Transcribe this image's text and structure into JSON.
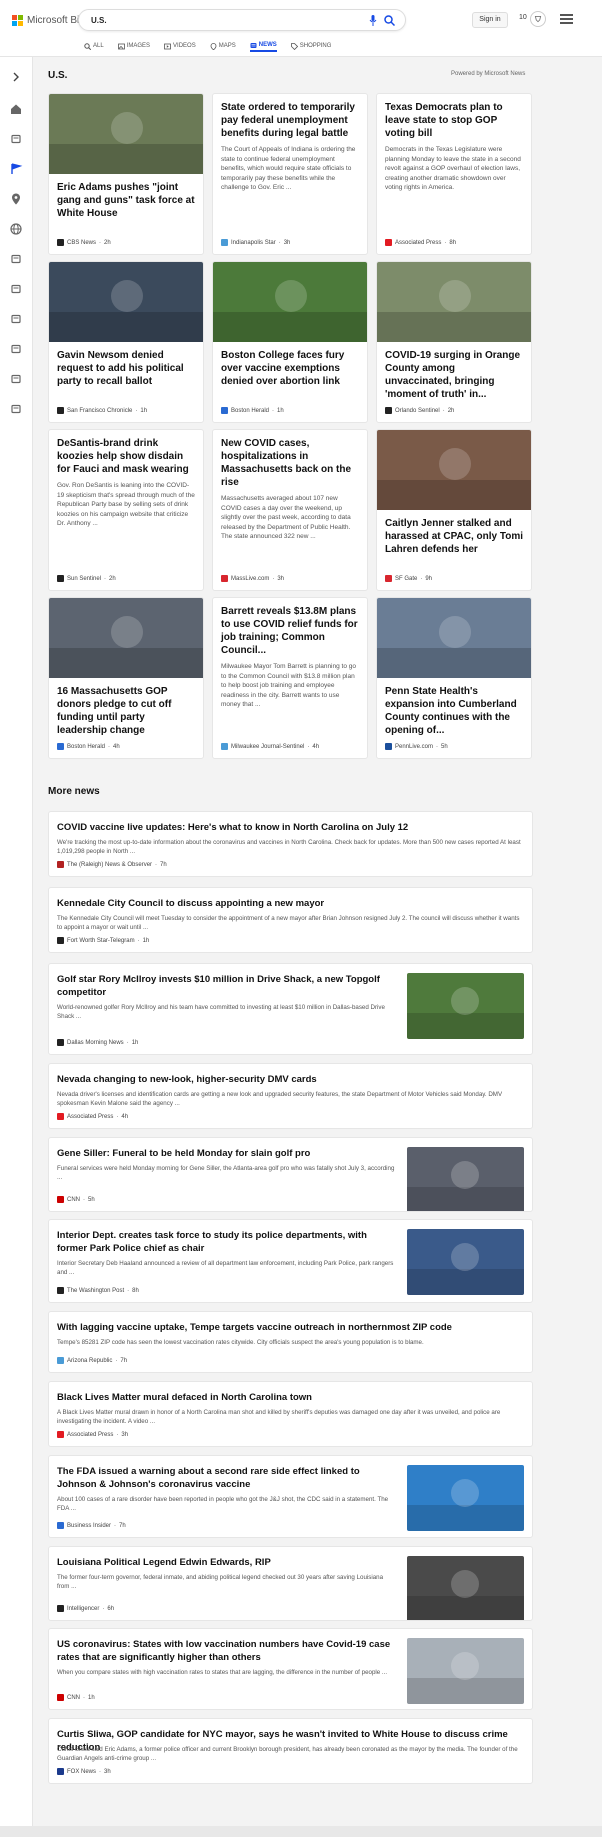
{
  "header": {
    "brand": "Microsoft Bing",
    "search_value": "U.S.",
    "sign_in": "Sign in",
    "points": "10",
    "logo_colors": [
      "#f25022",
      "#7fba00",
      "#00a4ef",
      "#ffb900"
    ],
    "accent": "#174ae4"
  },
  "nav": {
    "tabs": [
      {
        "label": "ALL",
        "icon": "search-icon"
      },
      {
        "label": "IMAGES",
        "icon": "image-icon"
      },
      {
        "label": "VIDEOS",
        "icon": "video-icon"
      },
      {
        "label": "MAPS",
        "icon": "map-pin-icon"
      },
      {
        "label": "NEWS",
        "icon": "news-icon",
        "active": true
      },
      {
        "label": "SHOPPING",
        "icon": "tag-icon"
      }
    ]
  },
  "sidebar": {
    "icons": [
      "chevron-right-icon",
      "home-icon",
      "trending-icon",
      "flag-icon",
      "location-icon",
      "globe-icon",
      "science-icon",
      "rocket-icon",
      "entertainment-icon",
      "sports-icon",
      "money-icon",
      "more-icon"
    ]
  },
  "main": {
    "section_title": "U.S.",
    "powered_by": "Powered by Microsoft News",
    "more_title": "More news",
    "cards": [
      {
        "title": "Eric Adams pushes \"joint gang and guns\" task force at White House",
        "excerpt": "",
        "source": "CBS News",
        "age": "2h",
        "has_image": true,
        "image_color": "#6b7a56",
        "logo_color": "#222"
      },
      {
        "title": "State ordered to temporarily pay federal unemployment benefits during legal battle",
        "excerpt": "The Court of Appeals of Indiana is ordering the state to continue federal unemployment benefits, which would require state officials to temporarily pay these benefits while the challenge to Gov. Eric ...",
        "source": "Indianapolis Star",
        "age": "3h",
        "has_image": false,
        "logo_color": "#4a9bd6"
      },
      {
        "title": "Texas Democrats plan to leave state to stop GOP voting bill",
        "excerpt": "Democrats in the Texas Legislature were planning Monday to leave the state in a second revolt against a GOP overhaul of election laws, creating another dramatic showdown over voting rights in America.",
        "source": "Associated Press",
        "age": "8h",
        "has_image": false,
        "logo_color": "#e21b22"
      },
      {
        "title": "Gavin Newsom denied request to add his political party to recall ballot",
        "excerpt": "",
        "source": "San Francisco Chronicle",
        "age": "1h",
        "has_image": true,
        "image_color": "#3b4a5c",
        "logo_color": "#222"
      },
      {
        "title": "Boston College faces fury over vaccine exemptions denied over abortion link",
        "excerpt": "",
        "source": "Boston Herald",
        "age": "1h",
        "has_image": true,
        "image_color": "#4c7a3a",
        "logo_color": "#2a6ad2"
      },
      {
        "title": "COVID-19 surging in Orange County among unvaccinated, bringing 'moment of truth' in...",
        "excerpt": "",
        "source": "Orlando Sentinel",
        "age": "2h",
        "has_image": true,
        "image_color": "#7d8c6a",
        "logo_color": "#222"
      },
      {
        "title": "DeSantis-brand drink koozies help show disdain for Fauci and mask wearing",
        "excerpt": "Gov. Ron DeSantis is leaning into the COVID-19 skepticism that's spread through much of the Republican Party base by selling sets of drink koozies on his campaign website that criticize Dr. Anthony ...",
        "source": "Sun Sentinel",
        "age": "2h",
        "has_image": false,
        "logo_color": "#222"
      },
      {
        "title": "New COVID cases, hospitalizations in Massachusetts back on the rise",
        "excerpt": "Massachusetts averaged about 107 new COVID cases a day over the weekend, up slightly over the past week, according to data released by the Department of Public Health. The state announced 322 new ...",
        "source": "MassLive.com",
        "age": "3h",
        "has_image": false,
        "logo_color": "#d8262e"
      },
      {
        "title": "Caitlyn Jenner stalked and harassed at CPAC, only Tomi Lahren defends her",
        "excerpt": "",
        "source": "SF Gate",
        "age": "9h",
        "has_image": true,
        "image_color": "#7a5a48",
        "logo_color": "#d8262e"
      },
      {
        "title": "16 Massachusetts GOP donors pledge to cut off funding until party leadership change",
        "excerpt": "",
        "source": "Boston Herald",
        "age": "4h",
        "has_image": true,
        "image_color": "#5c6470",
        "logo_color": "#2a6ad2"
      },
      {
        "title": "Barrett reveals $13.8M plans to use COVID relief funds for job training; Common Council...",
        "excerpt": "Milwaukee Mayor Tom Barrett is planning to go to the Common Council with $13.8 million plan to help boost job training and employee readiness in the city. Barrett wants to use money that ...",
        "source": "Milwaukee Journal-Sentinel",
        "age": "4h",
        "has_image": false,
        "logo_color": "#4a9bd6"
      },
      {
        "title": "Penn State Health's expansion into Cumberland County continues with the opening of...",
        "excerpt": "",
        "source": "PennLive.com",
        "age": "5h",
        "has_image": true,
        "image_color": "#6a7d95",
        "logo_color": "#1b4f9c"
      }
    ],
    "more_news": [
      {
        "title": "COVID vaccine live updates: Here's what to know in North Carolina on July 12",
        "excerpt": "We're tracking the most up-to-date information about the coronavirus and vaccines in North Carolina. Check back for updates. More than 500 new cases reported At least 1,019,298 people in North ...",
        "source": "The (Raleigh) News & Observer",
        "age": "7h",
        "has_image": false,
        "logo_color": "#b22222"
      },
      {
        "title": "Kennedale City Council to discuss appointing a new mayor",
        "excerpt": "The Kennedale City Council will meet Tuesday to consider the appointment of a new mayor after Brian Johnson resigned July 2. The council will discuss whether it wants to appoint a mayor or wait until ...",
        "source": "Fort Worth Star-Telegram",
        "age": "1h",
        "has_image": false,
        "logo_color": "#222"
      },
      {
        "title": "Golf star Rory McIlroy invests $10 million in Drive Shack, a new Topgolf competitor",
        "excerpt": "World-renowned golfer Rory McIlroy and his team have committed to investing at least $10 million in Dallas-based Drive Shack ...",
        "source": "Dallas Morning News",
        "age": "1h",
        "has_image": true,
        "image_color": "#4f7a3c",
        "logo_color": "#222"
      },
      {
        "title": "Nevada changing to new-look, higher-security DMV cards",
        "excerpt": "Nevada driver's licenses and identification cards are getting a new look and upgraded security features, the state Department of Motor Vehicles said Monday. DMV spokesman Kevin Malone said the agency ...",
        "source": "Associated Press",
        "age": "4h",
        "has_image": false,
        "logo_color": "#e21b22"
      },
      {
        "title": "Gene Siller: Funeral to be held Monday for slain golf pro",
        "excerpt": "Funeral services were held Monday morning for Gene Siller, the Atlanta-area golf pro who was fatally shot July 3, according ...",
        "source": "CNN",
        "age": "5h",
        "has_image": true,
        "image_color": "#5a5f6b",
        "logo_color": "#cc0000"
      },
      {
        "title": "Interior Dept. creates task force to study its police departments, with former Park Police chief as chair",
        "excerpt": "Interior Secretary Deb Haaland announced a review of all department law enforcement, including Park Police, park rangers and ...",
        "source": "The Washington Post",
        "age": "8h",
        "has_image": true,
        "image_color": "#3a5a8a",
        "logo_color": "#222"
      },
      {
        "title": "With lagging vaccine uptake, Tempe targets vaccine outreach in northernmost ZIP code",
        "excerpt": "Tempe's 85281 ZIP code has seen the lowest vaccination rates citywide. City officials suspect the area's young population is to blame.",
        "source": "Arizona Republic",
        "age": "7h",
        "has_image": false,
        "logo_color": "#4a9bd6"
      },
      {
        "title": "Black Lives Matter mural defaced in North Carolina town",
        "excerpt": "A Black Lives Matter mural drawn in honor of a North Carolina man shot and killed by sheriff's deputies was damaged one day after it was unveiled, and police are investigating the incident. A video ...",
        "source": "Associated Press",
        "age": "3h",
        "has_image": false,
        "logo_color": "#e21b22"
      },
      {
        "title": "The FDA issued a warning about a second rare side effect linked to Johnson & Johnson's coronavirus vaccine",
        "excerpt": "About 100 cases of a rare disorder have been reported in people who got the J&J shot, the CDC said in a statement. The FDA ...",
        "source": "Business Insider",
        "age": "7h",
        "has_image": true,
        "image_color": "#2f7fc8",
        "logo_color": "#2a6ad2"
      },
      {
        "title": "Louisiana Political Legend Edwin Edwards, RIP",
        "excerpt": "The former four-term governor, federal inmate, and abiding political legend checked out 30 years after saving Louisiana from ...",
        "source": "Intelligencer",
        "age": "6h",
        "has_image": true,
        "image_color": "#4a4a4a",
        "logo_color": "#222"
      },
      {
        "title": "US coronavirus: States with low vaccination numbers have Covid-19 case rates that are significantly higher than others",
        "excerpt": "When you compare states with high vaccination rates to states that are lagging, the difference in the number of people ...",
        "source": "CNN",
        "age": "1h",
        "has_image": true,
        "image_color": "#a8b0b8",
        "logo_color": "#cc0000"
      },
      {
        "title": "Curtis Sliwa, GOP candidate for NYC mayor, says he wasn't invited to White House to discuss crime reduction",
        "excerpt": "Curtis Sliwa said Eric Adams, a former police officer and current Brooklyn borough president, has already been coronated as the mayor by the media. The founder of the Guardian Angels anti-crime group ...",
        "source": "FOX News",
        "age": "3h",
        "has_image": false,
        "logo_color": "#1b3a8c"
      }
    ]
  }
}
